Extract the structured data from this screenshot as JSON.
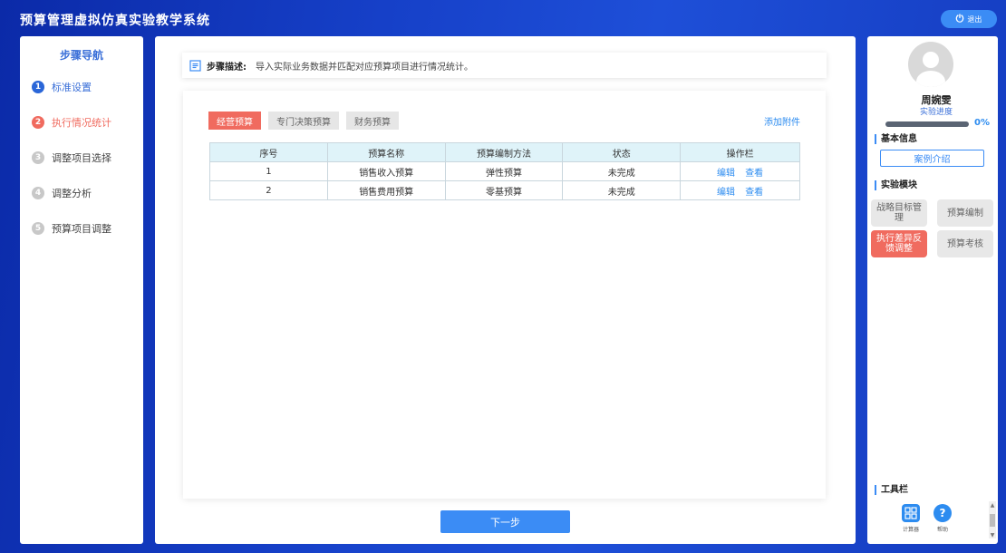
{
  "header": {
    "title": "预算管理虚拟仿真实验教学系统",
    "logout_label": "退出",
    "logout_icon": "power-icon"
  },
  "nav": {
    "title": "步骤导航",
    "items": [
      {
        "num": "1",
        "label": "标准设置",
        "state": "done"
      },
      {
        "num": "2",
        "label": "执行情况统计",
        "state": "active"
      },
      {
        "num": "3",
        "label": "调整项目选择",
        "state": "pending"
      },
      {
        "num": "4",
        "label": "调整分析",
        "state": "pending"
      },
      {
        "num": "5",
        "label": "预算项目调整",
        "state": "pending"
      }
    ]
  },
  "step_description": {
    "label": "步骤描述:",
    "text": "导入实际业务数据并匹配对应预算项目进行情况统计。"
  },
  "tabs": [
    {
      "label": "经营预算",
      "active": true
    },
    {
      "label": "专门决策预算",
      "active": false
    },
    {
      "label": "财务预算",
      "active": false
    }
  ],
  "attach_label": "添加附件",
  "table": {
    "headers": [
      "序号",
      "预算名称",
      "预算编制方法",
      "状态",
      "操作栏"
    ],
    "rows": [
      {
        "index": "1",
        "name": "销售收入预算",
        "method": "弹性预算",
        "status": "未完成",
        "edit": "编辑",
        "view": "查看"
      },
      {
        "index": "2",
        "name": "销售费用预算",
        "method": "零基预算",
        "status": "未完成",
        "edit": "编辑",
        "view": "查看"
      }
    ]
  },
  "next_label": "下一步",
  "user": {
    "name": "周婉雯",
    "progress_label": "实验进度",
    "progress": 0,
    "progress_text": "0%"
  },
  "sections": {
    "basic_info": "基本信息",
    "modules": "实验模块",
    "tools": "工具栏"
  },
  "case_intro_label": "案例介绍",
  "modules": [
    {
      "label": "战略目标管理",
      "active": false
    },
    {
      "label": "预算编制",
      "active": false
    },
    {
      "label": "执行差异反馈调整",
      "active": true
    },
    {
      "label": "预算考核",
      "active": false
    }
  ],
  "tools": [
    {
      "label": "计算器",
      "icon": "calculator-icon"
    },
    {
      "label": "帮助",
      "icon": "help-icon"
    }
  ],
  "colors": {
    "accent": "#3b8cf5",
    "active": "#f06b5f",
    "link": "#2d8cf0"
  }
}
